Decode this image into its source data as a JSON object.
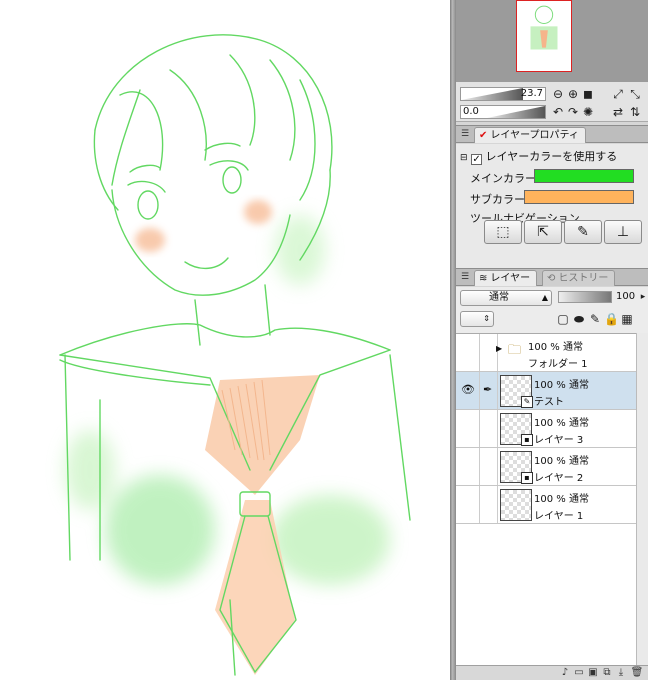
{
  "navigator": {
    "zoom_value": "23.7",
    "rotation_value": "0.0",
    "zoom_out_icon": "zoom-out-icon",
    "zoom_in_icon": "zoom-in-icon"
  },
  "layer_property": {
    "tab_label": "レイヤープロパティ",
    "use_layer_color_label": "レイヤーカラーを使用する",
    "use_layer_color_checked": true,
    "main_color_label": "メインカラー",
    "main_color": "#22dd22",
    "sub_color_label": "サブカラー",
    "sub_color": "#ffb35c",
    "tool_nav_label": "ツールナビゲーション"
  },
  "tabs": {
    "layer": "レイヤー",
    "history": "ヒストリー"
  },
  "layer_controls": {
    "blend_mode": "通常",
    "opacity": "100"
  },
  "layers": [
    {
      "line1": "100 % 通常",
      "line2": "フォルダー 1",
      "type": "folder",
      "selected": false,
      "visible": false
    },
    {
      "line1": "100 % 通常",
      "line2": "テスト",
      "type": "raster",
      "selected": true,
      "visible": true
    },
    {
      "line1": "100 % 通常",
      "line2": "レイヤー 3",
      "type": "raster",
      "selected": false,
      "visible": false
    },
    {
      "line1": "100 % 通常",
      "line2": "レイヤー 2",
      "type": "raster",
      "selected": false,
      "visible": false
    },
    {
      "line1": "100 % 通常",
      "line2": "レイヤー 1",
      "type": "raster",
      "selected": false,
      "visible": false
    }
  ],
  "colors": {
    "line_art": "#5fd95f",
    "blush": "#f6b48a"
  }
}
